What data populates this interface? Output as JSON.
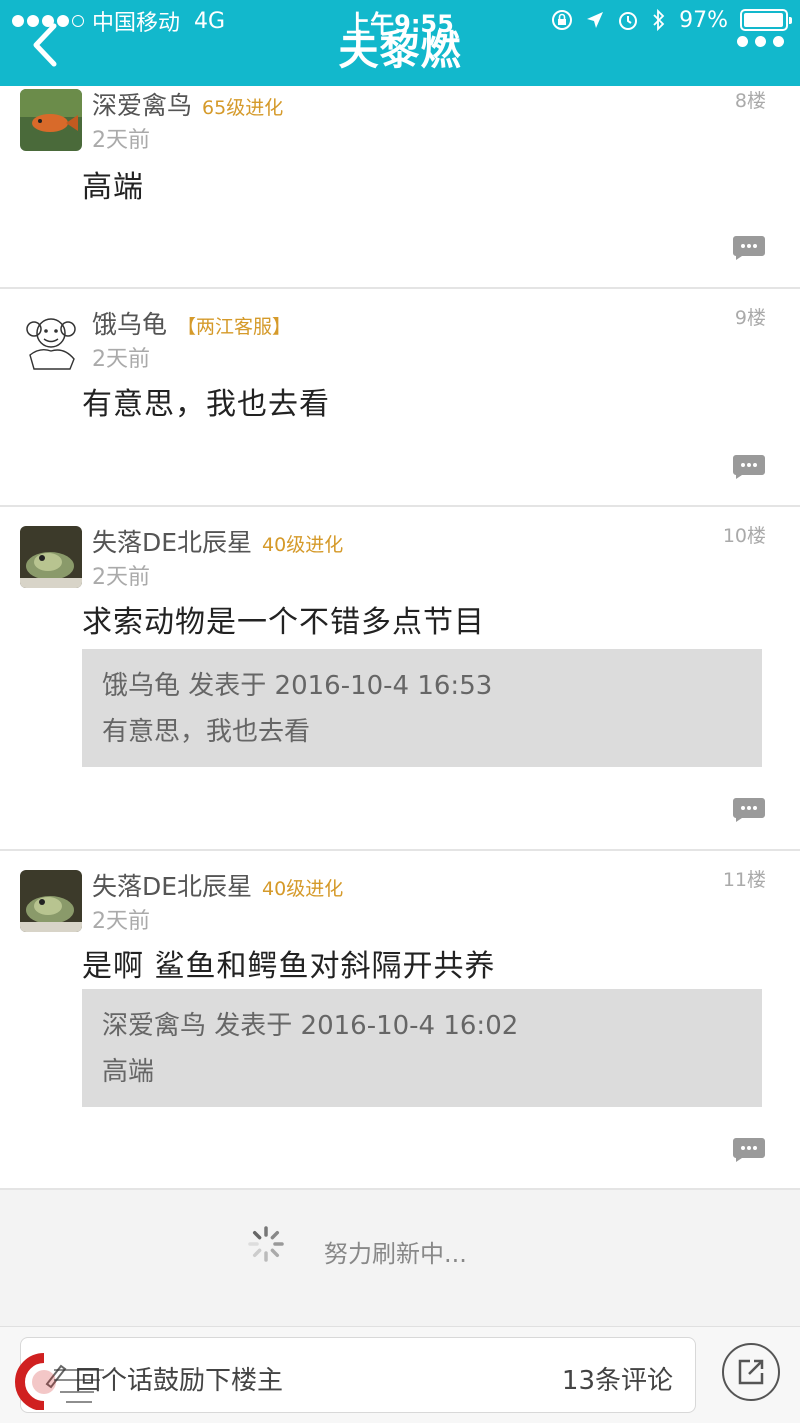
{
  "status_bar": {
    "carrier": "中国移动",
    "network": "4G",
    "time": "上午9:55",
    "battery_pct": "97%",
    "battery_level": 0.97
  },
  "nav": {
    "title": "夫黎燃"
  },
  "posts": [
    {
      "username": "深爱禽鸟",
      "badge": "65级进化",
      "floor": "8楼",
      "time": "2天前",
      "content": "高端"
    },
    {
      "username": "饿乌龟",
      "badge": "【两江客服】",
      "floor": "9楼",
      "time": "2天前",
      "content": "有意思，我也去看"
    },
    {
      "username": "失落DE北辰星",
      "badge": "40级进化",
      "floor": "10楼",
      "time": "2天前",
      "content": "求索动物是一个不错多点节目",
      "quote": {
        "meta": "饿乌龟 发表于 2016-10-4 16:53",
        "text": "有意思，我也去看"
      }
    },
    {
      "username": "失落DE北辰星",
      "badge": "40级进化",
      "floor": "11楼",
      "time": "2天前",
      "content": "是啊 鲨鱼和鳄鱼对斜隔开共养",
      "quote": {
        "meta": "深爱禽鸟 发表于 2016-10-4 16:02",
        "text": "高端"
      }
    }
  ],
  "loading": {
    "text": "努力刷新中..."
  },
  "bottom": {
    "reply_placeholder": "回个话鼓励下楼主",
    "comment_count": "13条评论"
  },
  "colors": {
    "accent": "#12b8cc",
    "badge": "#d59a2a"
  }
}
